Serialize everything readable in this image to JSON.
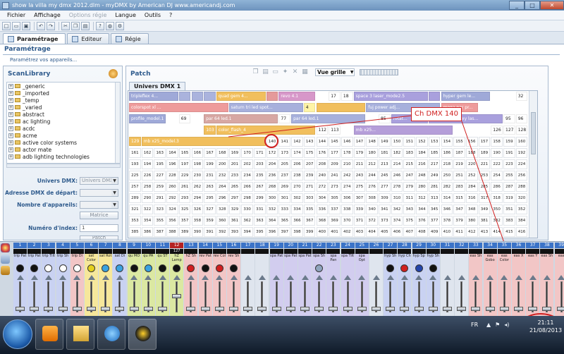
{
  "window": {
    "title": "show la villa my dmx 2012.dlm - myDMX     by American DJ     www.americandj.com",
    "minimize": "_",
    "maximize": "□",
    "close": "✕"
  },
  "menu": [
    {
      "label": "Fichier",
      "disabled": false
    },
    {
      "label": "Affichage",
      "disabled": false
    },
    {
      "label": "Options régie",
      "disabled": true
    },
    {
      "label": "Langue",
      "disabled": false
    },
    {
      "label": "Outils",
      "disabled": false
    },
    {
      "label": "?",
      "disabled": false
    }
  ],
  "toolbar": {
    "icons": [
      "new-icon",
      "open-icon",
      "save-icon",
      "undo-icon",
      "redo-icon",
      "cut-icon",
      "copy-icon",
      "paste-icon",
      "help-icon",
      "globe-icon",
      "gear-icon"
    ]
  },
  "tabs": [
    {
      "label": "Paramétrage",
      "active": true
    },
    {
      "label": "Editeur",
      "active": false
    },
    {
      "label": "Régie",
      "active": false
    }
  ],
  "page": {
    "title": "Paramétrage",
    "subtitle": "Paramétrez vos appareils..."
  },
  "scanlibrary": {
    "title": "ScanLibrary",
    "items": [
      "_generic",
      "_imported",
      "_temp",
      "_varied",
      "abstract",
      "ac lighting",
      "acdc",
      "acme",
      "active color systems",
      "actor mate",
      "adb lighting technologies"
    ]
  },
  "form": {
    "univers_label": "Univers DMX:",
    "univers_value": "Univers DMX",
    "adresse_label": "Adresse DMX de départ:",
    "adresse_value": "",
    "nombre_label": "Nombre d'appareils:",
    "nombre_value": "",
    "matrice_label": "Matrice",
    "index_label": "Numéro d'index:",
    "index_value": "1",
    "patch_label": "Patch"
  },
  "patch": {
    "title": "Patch",
    "view_label": "Vue grille",
    "universe_tab": "Univers DMX 1",
    "fixtures": [
      {
        "name": "tripleflex 4...",
        "start": 1,
        "len": 4,
        "color": "#9fa9d8"
      },
      {
        "name": "",
        "start": 5,
        "len": 1,
        "color": "#aab3dd"
      },
      {
        "name": "",
        "start": 6,
        "len": 1,
        "color": "#aab3dd"
      },
      {
        "name": "",
        "start": 7,
        "len": 1,
        "color": "#aab3dd"
      },
      {
        "name": "quad gem 4...",
        "start": 8,
        "len": 4,
        "color": "#f1bf5d"
      },
      {
        "name": "",
        "start": 12,
        "len": 1,
        "color": "#e59a9a"
      },
      {
        "name": "revo 4.1",
        "start": 13,
        "len": 3,
        "color": "#d797c9"
      },
      {
        "name": "17",
        "start": 17,
        "len": 1,
        "color": "#ffffff"
      },
      {
        "name": "18",
        "start": 18,
        "len": 1,
        "color": "#ffffff"
      },
      {
        "name": "space 3 laser_mode2.5",
        "start": 19,
        "len": 6,
        "color": "#a9a0dd"
      },
      {
        "name": "",
        "start": 25,
        "len": 1,
        "color": "#a9a0dd"
      },
      {
        "name": "hyper gem le...",
        "start": 26,
        "len": 4,
        "color": "#9fa9d8"
      },
      {
        "name": "32",
        "start": 32,
        "len": 1,
        "color": "#ffffff"
      },
      {
        "name": "colorspot xl ...",
        "start": 33,
        "len": 8,
        "color": "#ee9b9b"
      },
      {
        "name": "saturn tri led spot...",
        "start": 41,
        "len": 6,
        "color": "#a7b0dc"
      },
      {
        "name": "4",
        "start": 47,
        "len": 1,
        "color": "#fff4a6"
      },
      {
        "name": "",
        "start": 48,
        "len": 4,
        "color": "#f1bf5d"
      },
      {
        "name": "fuj power adj...",
        "start": 52,
        "len": 6,
        "color": "#a7b0dc"
      },
      {
        "name": "mega par pr...",
        "start": 58,
        "len": 3,
        "color": "#ee9b9b"
      },
      {
        "name": "profile_model.1",
        "start": 65,
        "len": 3,
        "color": "#9fa9d8"
      },
      {
        "name": "69",
        "start": 69,
        "len": 1,
        "color": "#ffffff"
      },
      {
        "name": "par 64 led.1",
        "start": 71,
        "len": 6,
        "color": "#d7a7a3"
      },
      {
        "name": "77",
        "start": 77,
        "len": 1,
        "color": "#ffffff"
      },
      {
        "name": "par 64 led.1",
        "start": 78,
        "len": 6,
        "color": "#a7b0dc"
      },
      {
        "name": "85",
        "start": 85,
        "len": 1,
        "color": "#ffffff"
      },
      {
        "name": "rotat...",
        "start": 86,
        "len": 3,
        "color": "#a9a0dd"
      },
      {
        "name": "lightmaxs galaxy las...",
        "start": 89,
        "len": 6,
        "color": "#a9a0dd"
      },
      {
        "name": "95",
        "start": 95,
        "len": 1,
        "color": "#ffffff"
      },
      {
        "name": "96",
        "start": 96,
        "len": 1,
        "color": "#ffffff"
      },
      {
        "name": "103",
        "start": 103,
        "len": 1,
        "color": "#f1bf5d"
      },
      {
        "name": "color_flash_4",
        "start": 104,
        "len": 8,
        "color": "#f1bf5d"
      },
      {
        "name": "112",
        "start": 112,
        "len": 1,
        "color": "#ffffff"
      },
      {
        "name": "113",
        "start": 113,
        "len": 1,
        "color": "#ffffff"
      },
      {
        "name": "mb x25...",
        "start": 115,
        "len": 8,
        "color": "#b59ed9"
      },
      {
        "name": "126",
        "start": 126,
        "len": 1,
        "color": "#ffffff"
      },
      {
        "name": "127",
        "start": 127,
        "len": 1,
        "color": "#ffffff"
      },
      {
        "name": "128",
        "start": 128,
        "len": 1,
        "color": "#ffffff"
      },
      {
        "name": "129",
        "start": 129,
        "len": 1,
        "color": "#f1bf5d"
      },
      {
        "name": "mb x25_model.3",
        "start": 130,
        "len": 10,
        "color": "#f1bf5d"
      }
    ],
    "free_start": 140,
    "free_end": 448
  },
  "callout": {
    "label": "Ch DMX 140"
  },
  "faders": [
    {
      "num": "1",
      "val": "",
      "lbl": "trip Pat",
      "icon": "#111",
      "color": "#c9d2f2"
    },
    {
      "num": "2",
      "val": "",
      "lbl": "trip Pat",
      "icon": "#111",
      "color": "#c9d2f2"
    },
    {
      "num": "3",
      "val": "",
      "lbl": "trip Tilt",
      "icon": "#fff",
      "color": "#c9d2f2"
    },
    {
      "num": "4",
      "val": "",
      "lbl": "trip Sh",
      "icon": "#fff",
      "color": "#c9d2f2"
    },
    {
      "num": "5",
      "val": "",
      "lbl": "trip Di",
      "icon": "#fff",
      "color": "#f2c6c6"
    },
    {
      "num": "6",
      "val": "",
      "lbl": "sat Color",
      "icon": "#e4d01c",
      "color": "#f6e79b"
    },
    {
      "num": "7",
      "val": "",
      "lbl": "sat Rot",
      "icon": "#3aa2e0",
      "color": "#f6e79b"
    },
    {
      "num": "8",
      "val": "",
      "lbl": "sat Di",
      "icon": "#3aa2e0",
      "color": "#c9d2f2"
    },
    {
      "num": "9",
      "val": "",
      "lbl": "qu MO",
      "icon": "#111",
      "color": "#dbe8a2"
    },
    {
      "num": "10",
      "val": "",
      "lbl": "qu PA",
      "icon": "#3aa2e0",
      "color": "#dbe8a2"
    },
    {
      "num": "11",
      "val": "",
      "lbl": "qu ST",
      "icon": "#111",
      "color": "#dbe8a2"
    },
    {
      "num": "12",
      "val": "127",
      "lbl": "hZ Lamp",
      "icon": "#111",
      "color": "#dbe8a2"
    },
    {
      "num": "13",
      "val": "",
      "lbl": "hZ Sh",
      "icon": "#d01f1f",
      "color": "#f2c6c6"
    },
    {
      "num": "14",
      "val": "",
      "lbl": "rev Pat",
      "icon": "#111",
      "color": "#f2c6c6"
    },
    {
      "num": "15",
      "val": "",
      "lbl": "rev Col",
      "icon": "#d01f1f",
      "color": "#f2c6c6"
    },
    {
      "num": "16",
      "val": "",
      "lbl": "rev Sh",
      "icon": "#111",
      "color": "#f2c6c6"
    },
    {
      "num": "17",
      "val": "",
      "lbl": "",
      "icon": "",
      "color": "#dfe5ee"
    },
    {
      "num": "18",
      "val": "",
      "lbl": "",
      "icon": "",
      "color": "#dfe5ee"
    },
    {
      "num": "19",
      "val": "",
      "lbl": "spa Pat",
      "icon": "",
      "color": "#d2cdef"
    },
    {
      "num": "20",
      "val": "",
      "lbl": "spa Pat",
      "icon": "",
      "color": "#d2cdef"
    },
    {
      "num": "21",
      "val": "",
      "lbl": "spa Pat",
      "icon": "",
      "color": "#d2cdef"
    },
    {
      "num": "22",
      "val": "",
      "lbl": "spa Sh",
      "icon": "#8fa4bd",
      "color": "#d2cdef"
    },
    {
      "num": "23",
      "val": "",
      "lbl": "spa Pan",
      "icon": "",
      "color": "#d2cdef"
    },
    {
      "num": "24",
      "val": "",
      "lbl": "spa Tilt",
      "icon": "",
      "color": "#d2cdef"
    },
    {
      "num": "25",
      "val": "",
      "lbl": "spa Opt",
      "icon": "",
      "color": "#d2cdef"
    },
    {
      "num": "26",
      "val": "",
      "lbl": "",
      "icon": "",
      "color": "#dfe5ee"
    },
    {
      "num": "27",
      "val": "",
      "lbl": "hyp Sh",
      "icon": "#111",
      "color": "#c9d2f2"
    },
    {
      "num": "28",
      "val": "",
      "lbl": "hyp Ch",
      "icon": "#d01f1f",
      "color": "#c9d2f2"
    },
    {
      "num": "29",
      "val": "",
      "lbl": "hyp Sp",
      "icon": "#2244aa",
      "color": "#c9d2f2"
    },
    {
      "num": "30",
      "val": "",
      "lbl": "hyp Sh",
      "icon": "#111",
      "color": "#c9d2f2"
    },
    {
      "num": "31",
      "val": "",
      "lbl": "",
      "icon": "",
      "color": "#dfe5ee"
    },
    {
      "num": "32",
      "val": "",
      "lbl": "",
      "icon": "",
      "color": "#dfe5ee"
    },
    {
      "num": "33",
      "val": "",
      "lbl": "eas Sh",
      "icon": "",
      "color": "#f2c6c6"
    },
    {
      "num": "34",
      "val": "",
      "lbl": "eas Gobo",
      "icon": "",
      "color": "#f2c6c6"
    },
    {
      "num": "35",
      "val": "",
      "lbl": "eas Color",
      "icon": "",
      "color": "#f2c6c6"
    },
    {
      "num": "36",
      "val": "",
      "lbl": "eas X",
      "icon": "",
      "color": "#f2c6c6"
    },
    {
      "num": "37",
      "val": "",
      "lbl": "eas Y",
      "icon": "",
      "color": "#f2c6c6"
    },
    {
      "num": "38",
      "val": "",
      "lbl": "eas Sh",
      "icon": "",
      "color": "#f2c6c6"
    },
    {
      "num": "39",
      "val": "",
      "lbl": "eas",
      "icon": "",
      "color": "#f2c6c6"
    }
  ],
  "taskbar": {
    "lang": "FR",
    "time": "21:11",
    "date": "21/08/2013"
  }
}
